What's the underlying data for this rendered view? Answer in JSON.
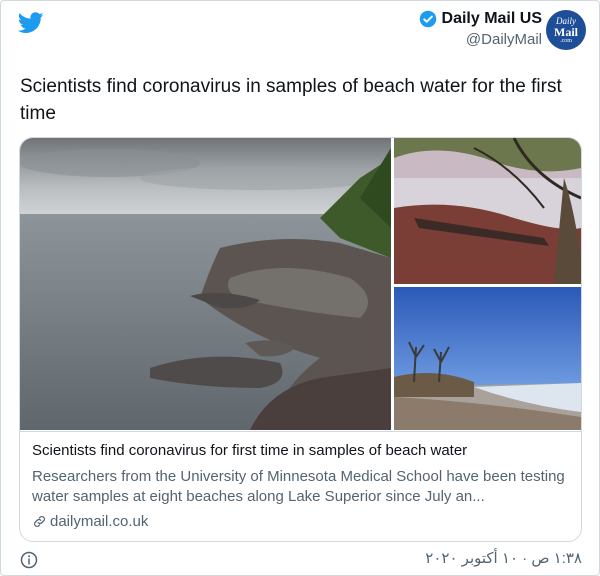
{
  "account": {
    "name": "Daily Mail US",
    "handle": "@DailyMail",
    "avatar_line1": "Daily",
    "avatar_line2": "Mail",
    "avatar_line3": ".com"
  },
  "tweet": {
    "text": "Scientists find coronavirus in samples of beach water for the first time"
  },
  "card": {
    "title": "Scientists find coronavirus for first time in samples of beach water",
    "description": "Researchers from the University of Minnesota Medical School have been testing water samples at eight beaches along Lake Superior since July an...",
    "domain": "dailymail.co.uk"
  },
  "footer": {
    "timestamp": "١:٣٨ ص · ١٠ أكتوبر ٢٠٢٠"
  },
  "colors": {
    "twitter_blue": "#1d9bf0",
    "daily_mail_blue": "#1e4e97",
    "secondary_text": "#536471",
    "border": "#cfd9de"
  },
  "icons": [
    "twitter-bird-icon",
    "verified-badge-icon",
    "link-icon",
    "info-icon"
  ]
}
